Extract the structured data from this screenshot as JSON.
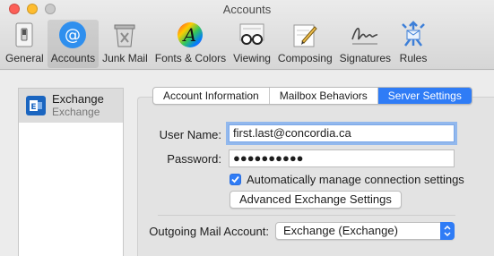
{
  "window": {
    "title": "Accounts",
    "traffic_colors": {
      "close": "#fd5f57",
      "minimize": "#febc2e",
      "zoom": "#c9c9c9"
    }
  },
  "toolbar": {
    "items": [
      {
        "label": "General",
        "icon": "switch-icon"
      },
      {
        "label": "Accounts",
        "icon": "at-sign-icon",
        "selected": true
      },
      {
        "label": "Junk Mail",
        "icon": "trash-icon"
      },
      {
        "label": "Fonts & Colors",
        "icon": "color-wheel-icon"
      },
      {
        "label": "Viewing",
        "icon": "glasses-icon"
      },
      {
        "label": "Composing",
        "icon": "pencil-icon"
      },
      {
        "label": "Signatures",
        "icon": "signature-icon"
      },
      {
        "label": "Rules",
        "icon": "rules-icon"
      }
    ]
  },
  "accounts": {
    "items": [
      {
        "name": "Exchange",
        "type": "Exchange",
        "icon": "exchange-icon",
        "selected": true
      }
    ]
  },
  "tabs": [
    {
      "label": "Account Information"
    },
    {
      "label": "Mailbox Behaviors"
    },
    {
      "label": "Server Settings",
      "active": true
    }
  ],
  "form": {
    "username_label": "User Name:",
    "username_value": "first.last@concordia.ca",
    "password_label": "Password:",
    "password_value": "●●●●●●●●●●",
    "auto_manage_label": "Automatically manage connection settings",
    "auto_manage_checked": true,
    "advanced_button": "Advanced Exchange Settings",
    "outgoing_label": "Outgoing Mail Account:",
    "outgoing_value": "Exchange (Exchange)"
  },
  "colors": {
    "accent": "#2f7cf6",
    "exchange_blue": "#1a65c0"
  }
}
